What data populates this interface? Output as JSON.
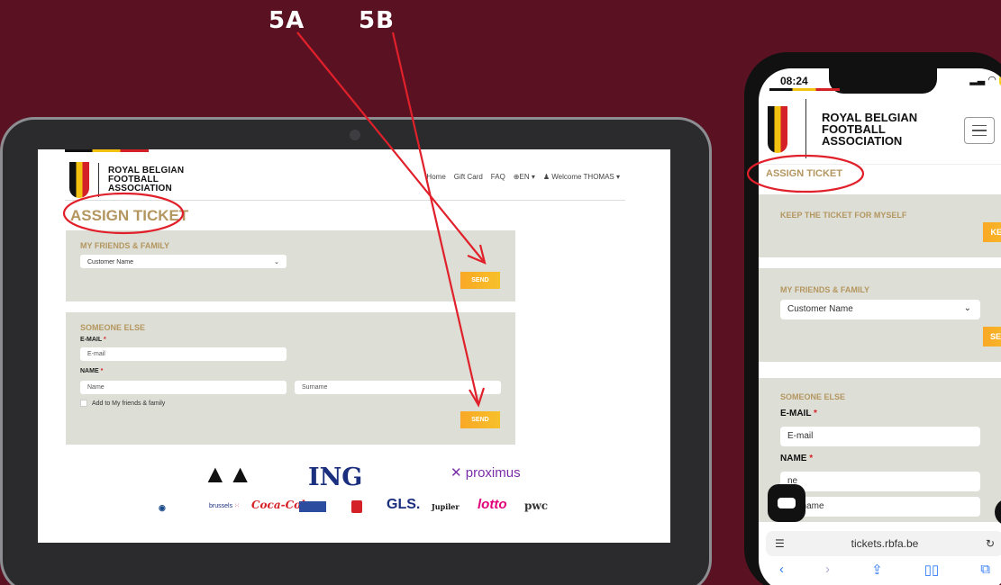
{
  "annotations": {
    "label_a": "5A",
    "label_b": "5B"
  },
  "colors": {
    "background": "#5a1222",
    "accent": "#b49660",
    "send": "#f9a825",
    "arrow": "#e0202a"
  },
  "tablet": {
    "logo": {
      "line1": "ROYAL BELGIAN",
      "line2": "FOOTBALL",
      "line3": "ASSOCIATION"
    },
    "nav": {
      "home": "Home",
      "gift": "Gift Card",
      "faq": "FAQ",
      "lang": "⊕EN ▾",
      "welcome": "♟ Welcome THOMAS ▾"
    },
    "title": "ASSIGN TICKET",
    "friends": {
      "heading": "MY FRIENDS & FAMILY",
      "select_value": "Customer Name",
      "send": "SEND"
    },
    "someone": {
      "heading": "SOMEONE ELSE",
      "email_label": "E-MAIL",
      "email_placeholder": "E-mail",
      "name_label": "NAME",
      "name_placeholder": "Name",
      "surname_placeholder": "Surname",
      "add_checkbox": "Add to My friends & family",
      "send": "SEND"
    },
    "sponsors": [
      "adidas",
      "ING",
      "proximus",
      "BMW",
      "brussels",
      "Coca-Cola",
      "Brussels Airlines",
      "Lotto",
      "GLS.",
      "Jupiler",
      "lotto",
      "pwc"
    ]
  },
  "phone": {
    "time": "08:24",
    "battery": "84",
    "logo": {
      "line1": "ROYAL BELGIAN",
      "line2": "FOOTBALL",
      "line3": "ASSOCIATION"
    },
    "title": "ASSIGN TICKET",
    "keep": {
      "heading": "KEEP THE TICKET FOR MYSELF",
      "button": "KEEP"
    },
    "friends": {
      "heading": "MY FRIENDS & FAMILY",
      "select_value": "Customer Name",
      "send": "SEND"
    },
    "someone": {
      "heading": "SOMEONE ELSE",
      "email_label": "E-MAIL",
      "email_placeholder": "E-mail",
      "name_label": "NAME",
      "name_placeholder": "ne",
      "surname_placeholder": "Surname"
    },
    "url": "tickets.rbfa.be"
  }
}
